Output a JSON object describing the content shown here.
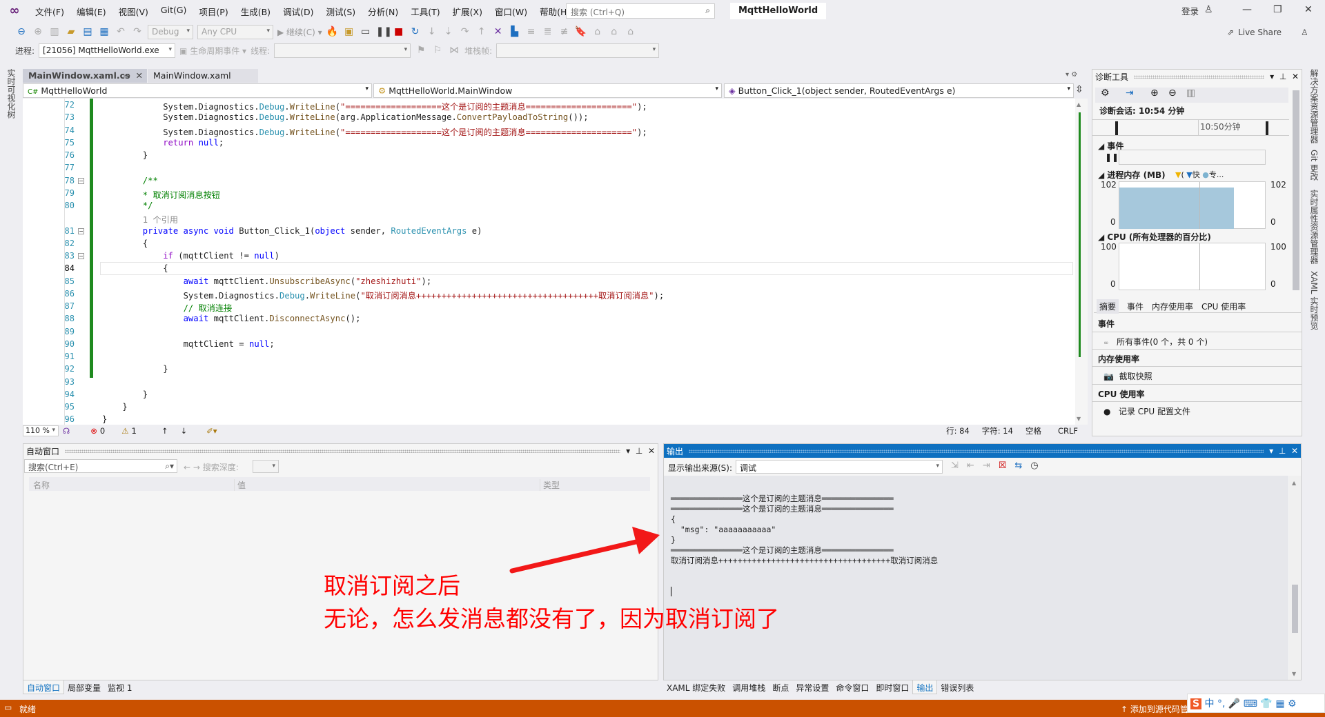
{
  "menu": {
    "items": [
      "文件(F)",
      "编辑(E)",
      "视图(V)",
      "Git(G)",
      "项目(P)",
      "生成(B)",
      "调试(D)",
      "测试(S)",
      "分析(N)",
      "工具(T)",
      "扩展(X)",
      "窗口(W)",
      "帮助(H)"
    ],
    "search_placeholder": "搜索 (Ctrl+Q)",
    "solution_title": "MqttHelloWorld",
    "signin": "登录"
  },
  "toolbar": {
    "config": "Debug",
    "platform": "Any CPU",
    "continue": "继续(C)",
    "live_share": "Live Share",
    "process_label": "进程:",
    "process": "[21056] MqttHelloWorld.exe",
    "lifecycle": "生命周期事件",
    "thread_label": "线程:",
    "stackframe_label": "堆栈帧:"
  },
  "left_strip": {
    "label": "实时可视化树"
  },
  "doc_tabs": [
    {
      "label": "MainWindow.xaml.cs",
      "active": true
    },
    {
      "label": "MainWindow.xaml",
      "active": false
    }
  ],
  "nav_bar": {
    "project": "MqttHelloWorld",
    "class": "MqttHelloWorld.MainWindow",
    "member": "Button_Click_1(object sender, RoutedEventArgs e)"
  },
  "code": [
    {
      "n": 72,
      "i": 12,
      "t": [
        [
          "System.Diagnostics.",
          ""
        ],
        [
          "Debug",
          "ty"
        ],
        [
          ".",
          ""
        ],
        [
          "WriteLine",
          "me"
        ],
        [
          "(",
          ""
        ],
        [
          "\"===================这个是订阅的主题消息=====================\"",
          "st"
        ],
        [
          ");",
          ""
        ]
      ]
    },
    {
      "n": 73,
      "i": 12,
      "t": [
        [
          "System.Diagnostics.",
          ""
        ],
        [
          "Debug",
          "ty"
        ],
        [
          ".",
          ""
        ],
        [
          "WriteLine",
          "me"
        ],
        [
          "(arg.ApplicationMessage.",
          ""
        ],
        [
          "ConvertPayloadToString",
          "me"
        ],
        [
          "());",
          ""
        ]
      ]
    },
    {
      "n": 74,
      "i": 12,
      "t": [
        [
          "System.Diagnostics.",
          ""
        ],
        [
          "Debug",
          "ty"
        ],
        [
          ".",
          ""
        ],
        [
          "WriteLine",
          "me"
        ],
        [
          "(",
          ""
        ],
        [
          "\"===================这个是订阅的主题消息=====================\"",
          "st"
        ],
        [
          ");",
          ""
        ]
      ]
    },
    {
      "n": 75,
      "i": 12,
      "t": [
        [
          "return",
          "ctl"
        ],
        [
          " ",
          ""
        ],
        [
          "null",
          "kw"
        ],
        [
          ";",
          ""
        ]
      ]
    },
    {
      "n": 76,
      "i": 8,
      "t": [
        [
          "}",
          ""
        ]
      ]
    },
    {
      "n": 77,
      "i": 0,
      "t": []
    },
    {
      "n": 78,
      "i": 8,
      "t": [
        [
          "/**",
          "cm"
        ]
      ]
    },
    {
      "n": 79,
      "i": 8,
      "t": [
        [
          "* 取消订阅消息按钮",
          "cm"
        ]
      ]
    },
    {
      "n": 80,
      "i": 8,
      "t": [
        [
          "*/",
          "cm"
        ]
      ]
    },
    {
      "n": null,
      "i": 8,
      "t": [
        [
          "1 个引用",
          "gr"
        ]
      ]
    },
    {
      "n": 81,
      "i": 8,
      "t": [
        [
          "private",
          "kw"
        ],
        [
          " ",
          ""
        ],
        [
          "async",
          "kw"
        ],
        [
          " ",
          ""
        ],
        [
          "void",
          "kw"
        ],
        [
          " Button_Click_1(",
          ""
        ],
        [
          "object",
          "kw"
        ],
        [
          " sender, ",
          ""
        ],
        [
          "RoutedEventArgs",
          "ty"
        ],
        [
          " e)",
          ""
        ]
      ]
    },
    {
      "n": 82,
      "i": 8,
      "t": [
        [
          "{",
          ""
        ]
      ]
    },
    {
      "n": 83,
      "i": 12,
      "t": [
        [
          "if",
          "ctl"
        ],
        [
          " (mqttClient != ",
          ""
        ],
        [
          "null",
          "kw"
        ],
        [
          ")",
          ""
        ]
      ]
    },
    {
      "n": 84,
      "i": 12,
      "t": [
        [
          "{",
          ""
        ]
      ]
    },
    {
      "n": 85,
      "i": 16,
      "t": [
        [
          "await",
          "kw"
        ],
        [
          " mqttClient.",
          ""
        ],
        [
          "UnsubscribeAsync",
          "me"
        ],
        [
          "(",
          ""
        ],
        [
          "\"zheshizhuti\"",
          "st"
        ],
        [
          ");",
          ""
        ]
      ]
    },
    {
      "n": 86,
      "i": 16,
      "t": [
        [
          "System.Diagnostics.",
          ""
        ],
        [
          "Debug",
          "ty"
        ],
        [
          ".",
          ""
        ],
        [
          "WriteLine",
          "me"
        ],
        [
          "(",
          ""
        ],
        [
          "\"取消订阅消息++++++++++++++++++++++++++++++++++++取消订阅消息\"",
          "st"
        ],
        [
          ");",
          ""
        ]
      ]
    },
    {
      "n": 87,
      "i": 16,
      "t": [
        [
          "// 取消连接",
          "cm"
        ]
      ]
    },
    {
      "n": 88,
      "i": 16,
      "t": [
        [
          "await",
          "kw"
        ],
        [
          " mqttClient.",
          ""
        ],
        [
          "DisconnectAsync",
          "me"
        ],
        [
          "();",
          ""
        ]
      ]
    },
    {
      "n": 89,
      "i": 0,
      "t": []
    },
    {
      "n": 90,
      "i": 16,
      "t": [
        [
          "mqttClient = ",
          ""
        ],
        [
          "null",
          "kw"
        ],
        [
          ";",
          ""
        ]
      ]
    },
    {
      "n": 91,
      "i": 0,
      "t": []
    },
    {
      "n": 92,
      "i": 12,
      "t": [
        [
          "}",
          ""
        ]
      ]
    },
    {
      "n": 93,
      "i": 0,
      "t": []
    },
    {
      "n": 94,
      "i": 8,
      "t": [
        [
          "}",
          ""
        ]
      ]
    },
    {
      "n": 95,
      "i": 4,
      "t": [
        [
          "}",
          ""
        ]
      ]
    },
    {
      "n": 96,
      "i": 0,
      "t": [
        [
          "}",
          ""
        ]
      ]
    },
    {
      "n": 97,
      "i": 0,
      "t": []
    }
  ],
  "current_line": 84,
  "editor_status": {
    "zoom": "110 %",
    "errors": "0",
    "warnings": "1",
    "line": "行: 84",
    "char": "字符: 14",
    "spaces": "空格",
    "eol": "CRLF"
  },
  "autos": {
    "title": "自动窗口",
    "search_placeholder": "搜索(Ctrl+E)",
    "search_depth": "搜索深度:",
    "columns": [
      "名称",
      "值",
      "类型"
    ]
  },
  "output": {
    "title": "输出",
    "source_label": "显示输出来源(S):",
    "source": "调试",
    "lines": [
      "═══════════════这个是订阅的主题消息═══════════════",
      "═══════════════这个是订阅的主题消息═══════════════",
      "{",
      "  \"msg\": \"aaaaaaaaaaa\"",
      "}",
      "═══════════════这个是订阅的主题消息═══════════════",
      "取消订阅消息++++++++++++++++++++++++++++++++++++取消订阅消息"
    ]
  },
  "bottom_tabs_left": [
    {
      "label": "自动窗口",
      "active": true
    },
    {
      "label": "局部变量",
      "active": false
    },
    {
      "label": "监视 1",
      "active": false
    }
  ],
  "bottom_tabs_right": [
    {
      "label": "XAML 绑定失败",
      "active": false
    },
    {
      "label": "调用堆栈",
      "active": false
    },
    {
      "label": "断点",
      "active": false
    },
    {
      "label": "异常设置",
      "active": false
    },
    {
      "label": "命令窗口",
      "active": false
    },
    {
      "label": "即时窗口",
      "active": false
    },
    {
      "label": "输出",
      "active": true
    },
    {
      "label": "错误列表",
      "active": false
    }
  ],
  "diag": {
    "title": "诊断工具",
    "session": "诊断会话: 10:54 分钟",
    "timeline_label": "10:50分钟",
    "events": "事件",
    "memory": "进程内存 (MB)",
    "mem_legend": [
      "(",
      "快",
      "专..."
    ],
    "mem_max": "102",
    "mem_min": "0",
    "cpu": "CPU (所有处理器的百分比)",
    "cpu_max": "100",
    "cpu_min": "0",
    "tabs": [
      "摘要",
      "事件",
      "内存使用率",
      "CPU 使用率"
    ],
    "sec_events": "事件",
    "all_events": "所有事件(0 个，共 0 个)",
    "sec_memory": "内存使用率",
    "snapshot": "截取快照",
    "sec_cpu": "CPU 使用率",
    "record_cpu": "记录 CPU 配置文件"
  },
  "right_strip": [
    "解决方案资源管理器",
    "Git 更改",
    "实时属性资源管理器",
    "XAML 实时预览"
  ],
  "status": {
    "ready": "就绪",
    "source_control": "添加到源代码管理"
  },
  "annotation": {
    "line1": "取消订阅之后",
    "line2": "无论，怎么发消息都没有了，因为取消订阅了",
    "color": "#ff0000"
  },
  "colors": {
    "accent": "#007acc",
    "status_bar": "#ca5100",
    "output_title": "#0e70c0"
  }
}
